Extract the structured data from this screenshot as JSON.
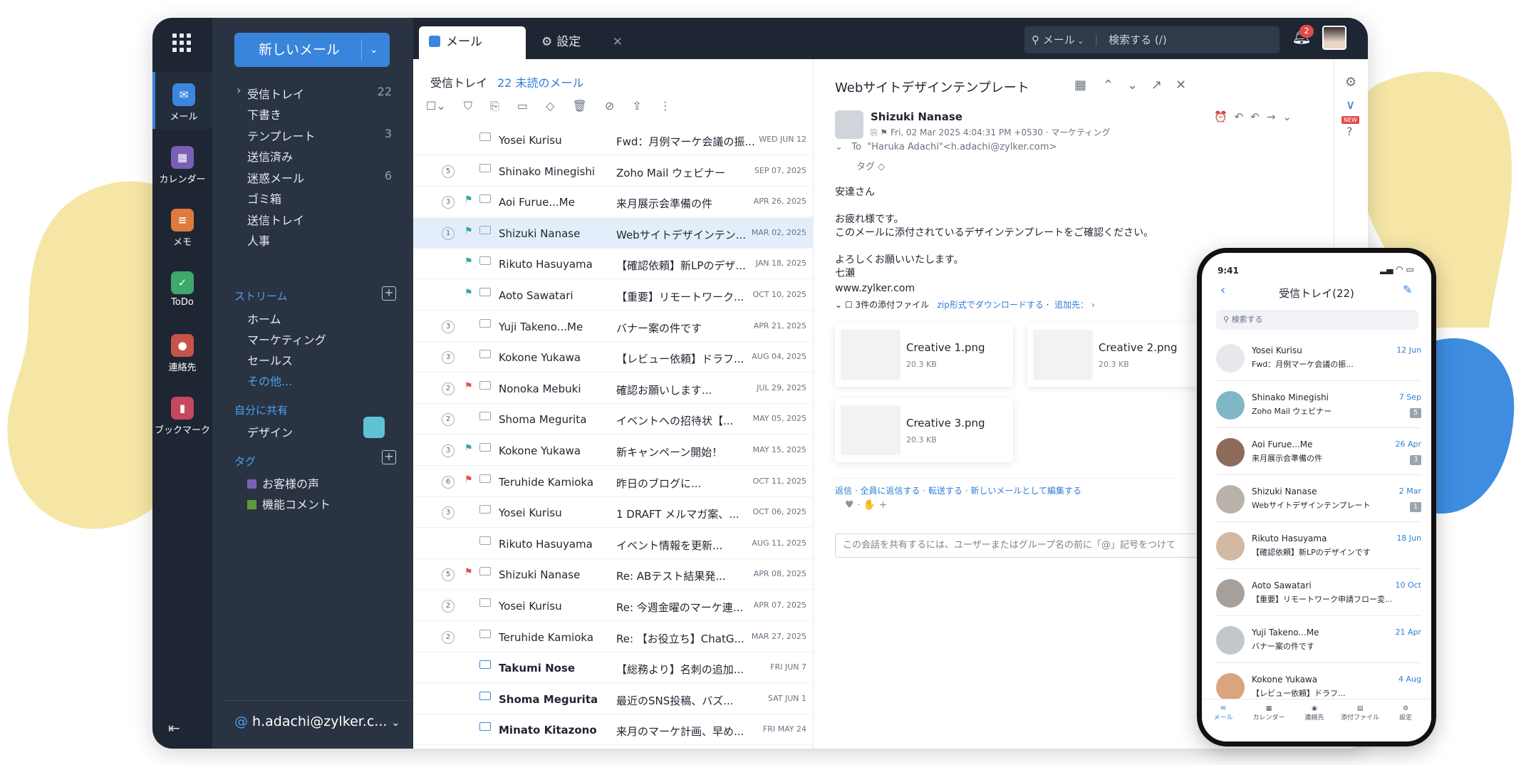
{
  "rail": {
    "items": [
      {
        "label": "メール",
        "color": "#3b87dd",
        "glyph": "✉"
      },
      {
        "label": "カレンダー",
        "color": "#7a5fb5",
        "glyph": "▦"
      },
      {
        "label": "メモ",
        "color": "#e07a3f",
        "glyph": "≡"
      },
      {
        "label": "ToDo",
        "color": "#3fa86b",
        "glyph": "✓"
      },
      {
        "label": "連絡先",
        "color": "#c7544a",
        "glyph": "●"
      },
      {
        "label": "ブックマーク",
        "color": "#c7475f",
        "glyph": "▮"
      }
    ]
  },
  "nav": {
    "new_mail": "新しいメール",
    "folders": [
      {
        "label": "受信トレイ",
        "count": "22"
      },
      {
        "label": "下書き",
        "count": ""
      },
      {
        "label": "テンプレート",
        "count": "3"
      },
      {
        "label": "送信済み",
        "count": ""
      },
      {
        "label": "迷惑メール",
        "count": "6"
      },
      {
        "label": "ゴミ箱",
        "count": ""
      },
      {
        "label": "送信トレイ",
        "count": ""
      },
      {
        "label": "人事",
        "count": ""
      }
    ],
    "streams_title": "ストリーム",
    "streams": [
      "ホーム",
      "マーケティング",
      "セールス"
    ],
    "streams_more": "その他...",
    "shared_title": "自分に共有",
    "shared": [
      "デザイン"
    ],
    "tags_title": "タグ",
    "tags": [
      {
        "label": "お客様の声",
        "color": "#7e5fb8"
      },
      {
        "label": "機能コメント",
        "color": "#5e9a3c"
      }
    ],
    "account": "h.adachi@zylker.c..."
  },
  "topbar": {
    "tab_mail": "メール",
    "tab_settings": "設定",
    "search_scope": "メール",
    "search_placeholder": "検索する (/)",
    "bell_count": "2"
  },
  "list": {
    "folder": "受信トレイ",
    "unread": "22 未読のメール",
    "rows": [
      {
        "count": "",
        "flag": "",
        "sender": "Yosei Kurisu",
        "subject": "Fwd：月例マーケ会議の振...",
        "date": "WED JUN 12",
        "unread": false,
        "sel": false
      },
      {
        "count": "5",
        "flag": "",
        "sender": "Shinako Minegishi",
        "subject": "Zoho Mail ウェビナー",
        "date": "SEP 07, 2025",
        "unread": false,
        "sel": false
      },
      {
        "count": "3",
        "flag": "teal",
        "sender": "Aoi Furue...Me",
        "subject": "来月展示会準備の件",
        "date": "APR 26, 2025",
        "unread": false,
        "sel": false
      },
      {
        "count": "1",
        "flag": "teal",
        "sender": "Shizuki Nanase",
        "subject": "Webサイトデザインテン...",
        "date": "MAR 02, 2025",
        "unread": false,
        "sel": true
      },
      {
        "count": "",
        "flag": "teal",
        "sender": "Rikuto Hasuyama",
        "subject": "【確認依頼】新LPのデザ...",
        "date": "JAN 18, 2025",
        "unread": false,
        "sel": false
      },
      {
        "count": "",
        "flag": "teal",
        "sender": "Aoto Sawatari",
        "subject": "【重要】リモートワーク...",
        "date": "OCT 10, 2025",
        "unread": false,
        "sel": false
      },
      {
        "count": "3",
        "flag": "",
        "sender": "Yuji Takeno...Me",
        "subject": "バナー案の件です",
        "date": "APR 21, 2025",
        "unread": false,
        "sel": false
      },
      {
        "count": "3",
        "flag": "",
        "sender": "Kokone Yukawa",
        "subject": "【レビュー依頼】ドラフ...",
        "date": "AUG 04, 2025",
        "unread": false,
        "sel": false
      },
      {
        "count": "2",
        "flag": "red",
        "sender": "Nonoka Mebuki",
        "subject": "確認お願いします...",
        "date": "JUL 29, 2025",
        "unread": false,
        "sel": false
      },
      {
        "count": "2",
        "flag": "",
        "sender": "Shoma Megurita",
        "subject": "イベントへの招待状【...",
        "date": "MAY 05, 2025",
        "unread": false,
        "sel": false
      },
      {
        "count": "3",
        "flag": "teal",
        "sender": "Kokone Yukawa",
        "subject": "新キャンペーン開始！",
        "date": "MAY 15, 2025",
        "unread": false,
        "sel": false
      },
      {
        "count": "6",
        "flag": "red",
        "sender": "Teruhide Kamioka",
        "subject": "昨日のブログに...",
        "date": "OCT 11, 2025",
        "unread": false,
        "sel": false
      },
      {
        "count": "3",
        "flag": "",
        "sender": "Yosei Kurisu",
        "subject": "1 DRAFT メルマガ案、...",
        "date": "OCT 06, 2025",
        "unread": false,
        "sel": false
      },
      {
        "count": "",
        "flag": "",
        "sender": "Rikuto Hasuyama",
        "subject": "イベント情報を更新...",
        "date": "AUG 11, 2025",
        "unread": false,
        "sel": false
      },
      {
        "count": "5",
        "flag": "red",
        "sender": "Shizuki Nanase",
        "subject": "Re: ABテスト結果発...",
        "date": "APR 08, 2025",
        "unread": false,
        "sel": false
      },
      {
        "count": "2",
        "flag": "",
        "sender": "Yosei Kurisu",
        "subject": "Re: 今週金曜のマーケ連...",
        "date": "APR 07, 2025",
        "unread": false,
        "sel": false
      },
      {
        "count": "2",
        "flag": "",
        "sender": "Teruhide Kamioka",
        "subject": "Re: 【お役立ち】ChatG...",
        "date": "MAR 27, 2025",
        "unread": false,
        "sel": false
      },
      {
        "count": "",
        "flag": "",
        "sender": "Takumi Nose",
        "subject": "【総務より】名刺の追加...",
        "date": "FRI JUN 7",
        "unread": true,
        "sel": false
      },
      {
        "count": "",
        "flag": "",
        "sender": "Shoma Megurita",
        "subject": "最近のSNS投稿、バズ...",
        "date": "SAT JUN 1",
        "unread": true,
        "sel": false
      },
      {
        "count": "",
        "flag": "",
        "sender": "Minato Kitazono",
        "subject": "来月のマーケ計画、早め...",
        "date": "FRI MAY 24",
        "unread": true,
        "sel": false
      }
    ]
  },
  "reader": {
    "title": "Webサイトデザインテンプレート",
    "from": "Shizuki Nanase",
    "meta": "Fri, 02 Mar 2025 4:04:31 PM +0530",
    "label": "マーケティング",
    "to_label": "To",
    "to": "\"Haruka Adachi\"<h.adachi@zylker.com>",
    "tag_label": "タグ",
    "greeting": "安達さん",
    "body1": "お疲れ様です。",
    "body2": "このメールに添付されているデザインテンプレートをご確認ください。",
    "body3": "よろしくお願いいたします。",
    "sign": "七瀬",
    "site": "www.zylker.com",
    "attach_count": "3件の添付ファイル",
    "zip": "zip形式でダウンロードする",
    "add": "追加先：",
    "attachments": [
      {
        "name": "Creative 1.png",
        "size": "20.3 KB"
      },
      {
        "name": "Creative 2.png",
        "size": "20.3 KB"
      },
      {
        "name": "Creative 3.png",
        "size": "20.3 KB"
      }
    ],
    "actions": [
      "返信",
      "全員に返信する",
      "転送する",
      "新しいメールとして編集する"
    ],
    "share_placeholder": "この会話を共有するには、ユーザーまたはグループ名の前に「@」記号をつけて"
  },
  "phone": {
    "time": "9:41",
    "title": "受信トレイ(22)",
    "search": "検索する",
    "rows": [
      {
        "name": "Yosei Kurisu",
        "subject": "Fwd：月例マーケ会議の振...",
        "date": "12 Jun",
        "count": ""
      },
      {
        "name": "Shinako Minegishi",
        "subject": "Zoho Mail ウェビナー",
        "date": "7 Sep",
        "count": "5"
      },
      {
        "name": "Aoi Furue...Me",
        "subject": "来月展示会準備の件",
        "date": "26 Apr",
        "count": "3"
      },
      {
        "name": "Shizuki Nanase",
        "subject": "Webサイトデザインテンプレート",
        "date": "2 Mar",
        "count": "1"
      },
      {
        "name": "Rikuto Hasuyama",
        "subject": "【確認依頼】新LPのデザインです",
        "date": "18 Jun",
        "count": ""
      },
      {
        "name": "Aoto Sawatari",
        "subject": "【重要】リモートワーク申請フロー変...",
        "date": "10 Oct",
        "count": ""
      },
      {
        "name": "Yuji Takeno...Me",
        "subject": "バナー案の件です",
        "date": "21 Apr",
        "count": ""
      },
      {
        "name": "Kokone Yukawa",
        "subject": "【レビュー依頼】ドラフ...",
        "date": "4 Aug",
        "count": ""
      }
    ],
    "tabs": [
      "メール",
      "カレンダー",
      "連絡先",
      "添付ファイル",
      "設定"
    ]
  }
}
